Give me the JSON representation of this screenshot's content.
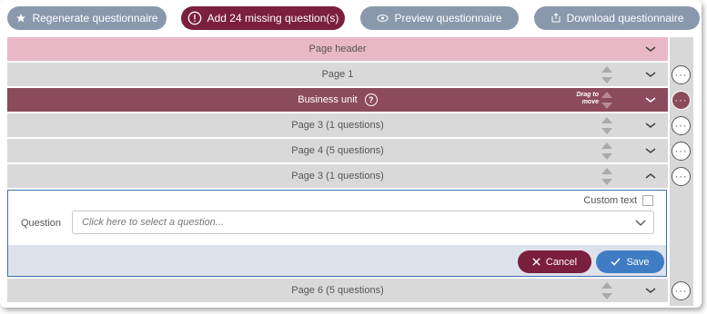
{
  "toolbar": {
    "regenerate_label": "Regenerate questionnaire",
    "add_missing_label": "Add 24 missing question(s)",
    "preview_label": "Preview questionnaire",
    "download_label": "Download questionnaire"
  },
  "rows": {
    "page_header": "Page header",
    "page1": "Page 1",
    "business_unit": "Business unit",
    "page3a": "Page 3 (1 questions)",
    "page4": "Page 4 (5 questions)",
    "page3b": "Page 3 (1 questions)",
    "page6": "Page 6 (5 questions)"
  },
  "drag_hint": {
    "line1": "Drag to",
    "line2": "move"
  },
  "panel": {
    "custom_text_label": "Custom text",
    "question_label": "Question",
    "question_placeholder": "Click here to select a question...",
    "cancel_label": "Cancel",
    "save_label": "Save"
  },
  "colors": {
    "grey_button": "#8a98ad",
    "maroon": "#7a1f3d",
    "active_row": "#8c4b5c",
    "header_row": "#e9b8c6",
    "save_blue": "#3f7cc4"
  }
}
